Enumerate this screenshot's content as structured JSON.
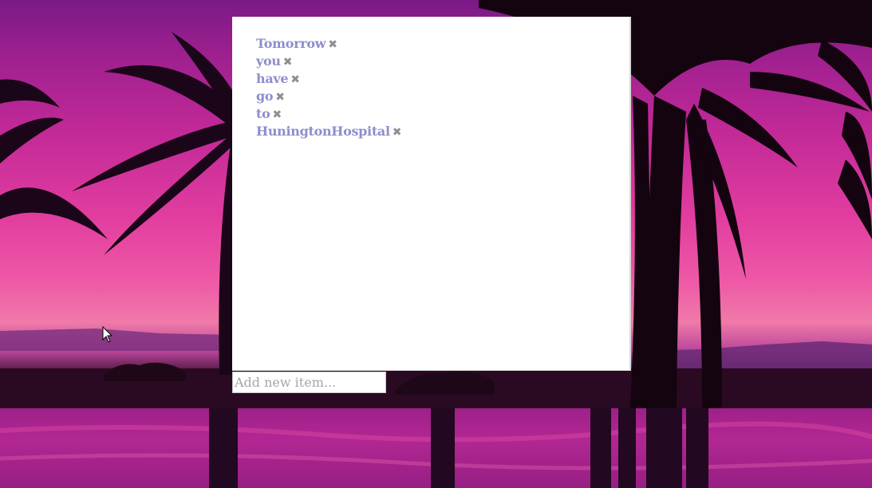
{
  "todo": {
    "items": [
      {
        "text": "Tomorrow",
        "remove_icon": "close-icon"
      },
      {
        "text": "you",
        "remove_icon": "close-icon"
      },
      {
        "text": "have",
        "remove_icon": "close-icon"
      },
      {
        "text": "go",
        "remove_icon": "close-icon"
      },
      {
        "text": "to",
        "remove_icon": "close-icon"
      },
      {
        "text": "HuningtonHospital",
        "remove_icon": "close-icon"
      }
    ],
    "remove_glyph": "✖",
    "new_item_placeholder": "Add new item...",
    "new_item_value": ""
  },
  "colors": {
    "item_text": "#8e8dcc",
    "remove_icon": "#8f8f8f",
    "panel_background": "#ffffff",
    "wallpaper_sky": "#e23e9f"
  }
}
